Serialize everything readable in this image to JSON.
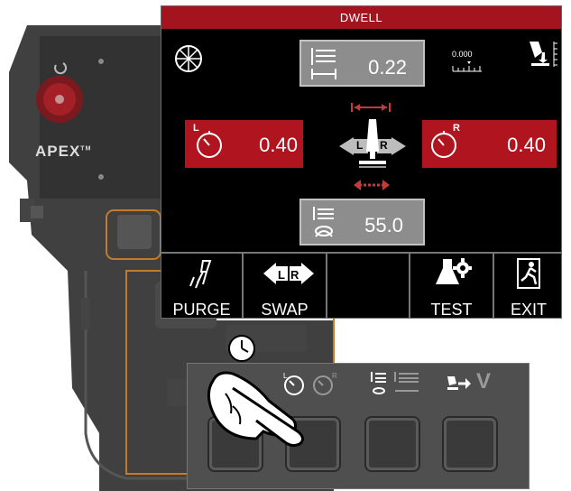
{
  "screen": {
    "title": "DWELL",
    "stick_out": {
      "value": "0.22",
      "scale_text": "0.000"
    },
    "left_dwell": {
      "value": "0.40",
      "side": "L"
    },
    "right_dwell": {
      "value": "0.40",
      "side": "R"
    },
    "center_torch": {
      "left": "L",
      "right": "R"
    },
    "weave_width": {
      "value": "55.0"
    }
  },
  "toolbar": {
    "purge_label": "PURGE",
    "swap_label": "SWAP",
    "test_label": "TEST",
    "exit_label": "EXIT"
  },
  "pendant": {
    "brand": "APEX",
    "tm": "TM"
  },
  "panel": {
    "v_label": "V"
  },
  "colors": {
    "title_red": "#a4141f",
    "value_red": "#b0141f",
    "value_gray": "#8d8d8d"
  }
}
